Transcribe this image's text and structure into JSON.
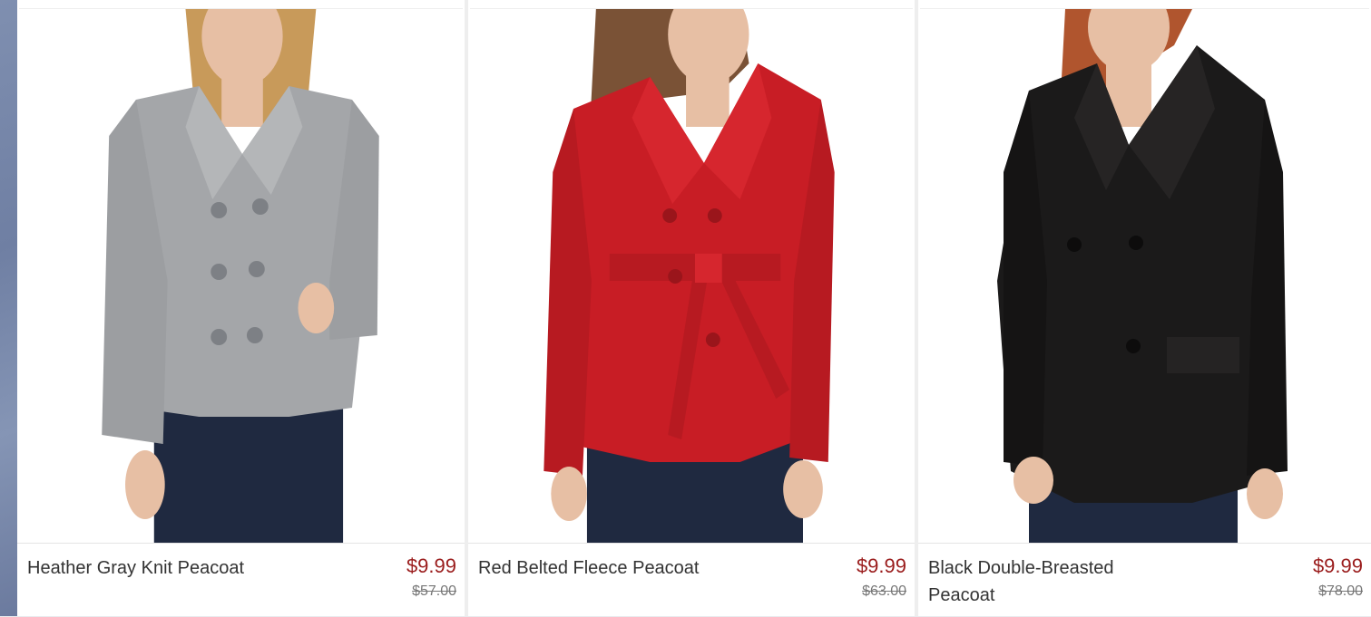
{
  "products": [
    {
      "name": "Heather Gray Knit Peacoat",
      "price": "$9.99",
      "original_price": "$57.00",
      "coat_color": "#a4a6a9",
      "hair_color": "#c89a5a"
    },
    {
      "name": "Red Belted Fleece Peacoat",
      "price": "$9.99",
      "original_price": "$63.00",
      "coat_color": "#c81d25",
      "hair_color": "#7a5236"
    },
    {
      "name": "Black Double-Breasted Peacoat",
      "price": "$9.99",
      "original_price": "$78.00",
      "coat_color": "#1b1a1a",
      "hair_color": "#b0552e"
    }
  ],
  "colors": {
    "price": "#9a1c1c",
    "original_price": "#777777",
    "jeans": "#1f2940",
    "skin": "#e7bfa4"
  }
}
